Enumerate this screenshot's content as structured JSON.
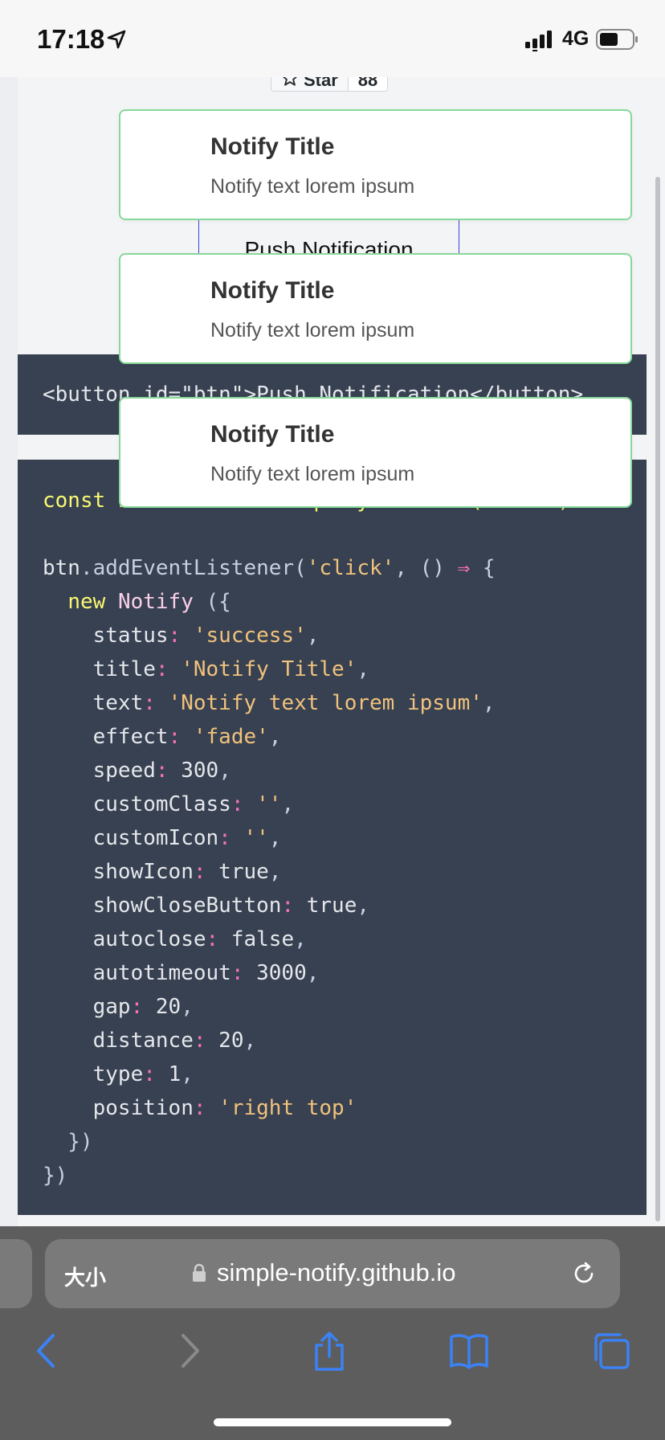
{
  "status_bar": {
    "time": "17:18",
    "network": "4G"
  },
  "github": {
    "star_label": "Star",
    "star_count": "88"
  },
  "demo_button": {
    "label": "Push Notification"
  },
  "html_code": "<button id=\"btn\">Push Notification</button>",
  "notifications": [
    {
      "title": "Notify Title",
      "text": "Notify text lorem ipsum"
    },
    {
      "title": "Notify Title",
      "text": "Notify text lorem ipsum"
    },
    {
      "title": "Notify Title",
      "text": "Notify text lorem ipsum"
    }
  ],
  "js_code": {
    "line1": "const btn = document.querySelector('#btn')",
    "listener_obj": "btn",
    "listener_method": ".addEventListener(",
    "event": "'click'",
    "new_kw": "new",
    "class_name": "Notify",
    "options": [
      {
        "key": "status",
        "value": "'success'",
        "type": "str"
      },
      {
        "key": "title",
        "value": "'Notify Title'",
        "type": "str"
      },
      {
        "key": "text",
        "value": "'Notify text lorem ipsum'",
        "type": "str"
      },
      {
        "key": "effect",
        "value": "'fade'",
        "type": "str"
      },
      {
        "key": "speed",
        "value": "300",
        "type": "num"
      },
      {
        "key": "customClass",
        "value": "''",
        "type": "str"
      },
      {
        "key": "customIcon",
        "value": "''",
        "type": "str"
      },
      {
        "key": "showIcon",
        "value": "true",
        "type": "num"
      },
      {
        "key": "showCloseButton",
        "value": "true",
        "type": "num"
      },
      {
        "key": "autoclose",
        "value": "false",
        "type": "num"
      },
      {
        "key": "autotimeout",
        "value": "3000",
        "type": "num"
      },
      {
        "key": "gap",
        "value": "20",
        "type": "num"
      },
      {
        "key": "distance",
        "value": "20",
        "type": "num"
      },
      {
        "key": "type",
        "value": "1",
        "type": "num"
      },
      {
        "key": "position",
        "value": "'right top'",
        "type": "str",
        "last": true
      }
    ]
  },
  "browser": {
    "aa_label": "大小",
    "url": "simple-notify.github.io"
  },
  "icons": [
    "location-arrow-icon",
    "signal-icon",
    "battery-icon",
    "star-icon",
    "lock-icon",
    "reload-icon",
    "back-icon",
    "forward-icon",
    "share-icon",
    "bookmarks-icon",
    "tabs-icon"
  ]
}
